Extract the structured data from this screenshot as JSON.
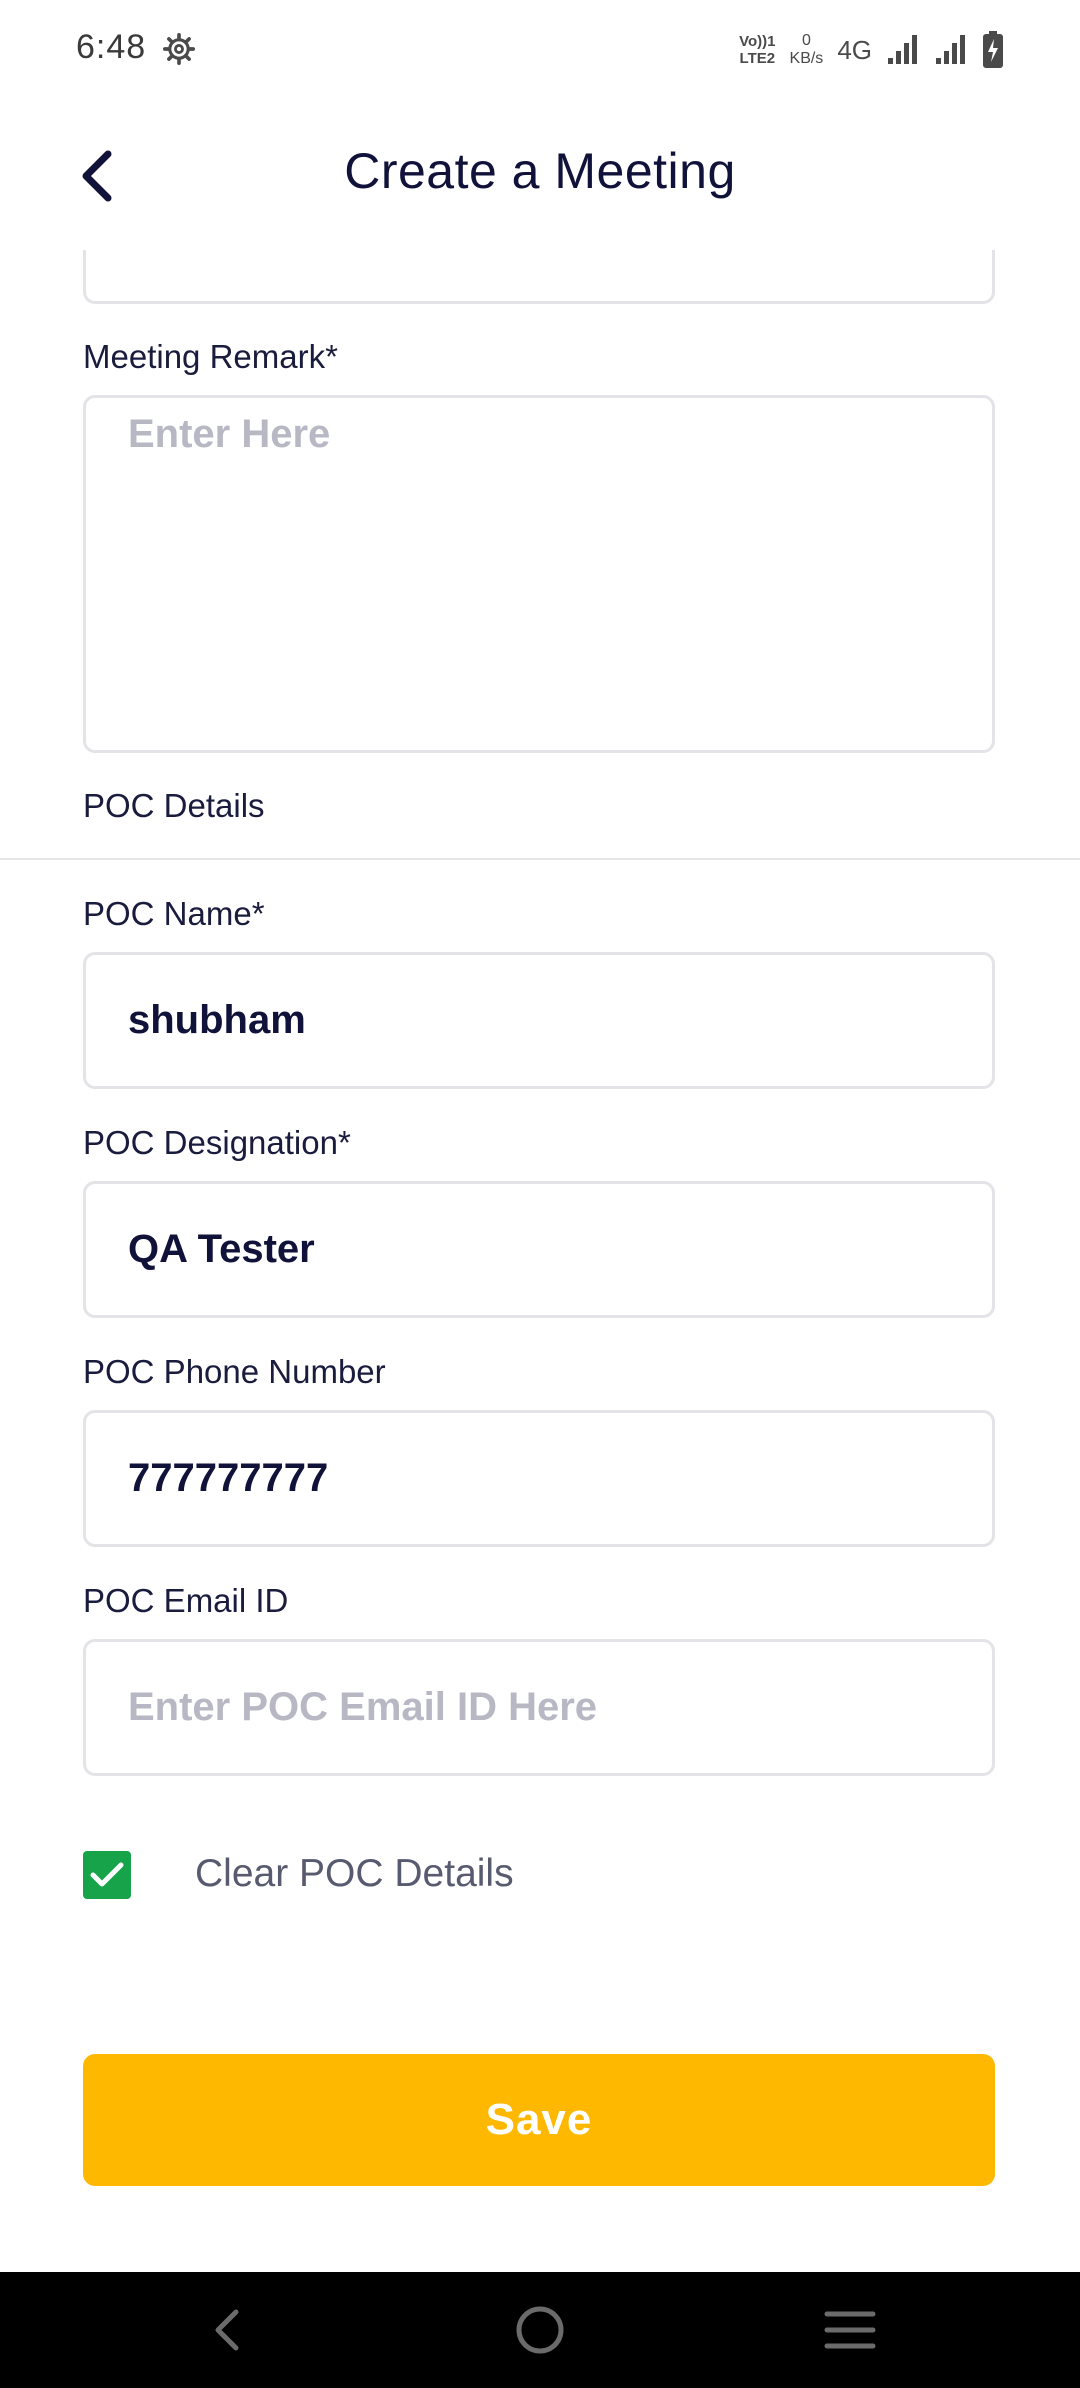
{
  "status_bar": {
    "time": "6:48",
    "volte_top": "Vo))1",
    "volte_bottom": "LTE2",
    "data_rate_value": "0",
    "data_rate_unit": "KB/s",
    "network_type": "4G"
  },
  "header": {
    "title": "Create a Meeting"
  },
  "form": {
    "meeting_remark": {
      "label": "Meeting Remark*",
      "placeholder": "Enter Here",
      "value": ""
    },
    "poc_section_label": "POC Details",
    "poc_name": {
      "label": "POC Name*",
      "value": "shubham"
    },
    "poc_designation": {
      "label": "POC Designation*",
      "value": "QA Tester"
    },
    "poc_phone": {
      "label": "POC Phone Number",
      "value": "777777777"
    },
    "poc_email": {
      "label": "POC Email ID",
      "placeholder": "Enter POC Email ID Here",
      "value": ""
    },
    "clear_poc": {
      "label": "Clear POC Details",
      "checked": true
    }
  },
  "actions": {
    "save_label": "Save"
  },
  "colors": {
    "primary_text": "#10123a",
    "accent": "#ffb800",
    "checkbox": "#16a34a",
    "placeholder": "#b7b8c4",
    "border": "#e3e3e8"
  },
  "icons": {
    "back": "chevron-left-icon",
    "settings": "gear-icon",
    "checkbox": "check-icon",
    "nav_back": "nav-back-icon",
    "nav_home": "nav-home-icon",
    "nav_menu": "nav-menu-icon"
  }
}
